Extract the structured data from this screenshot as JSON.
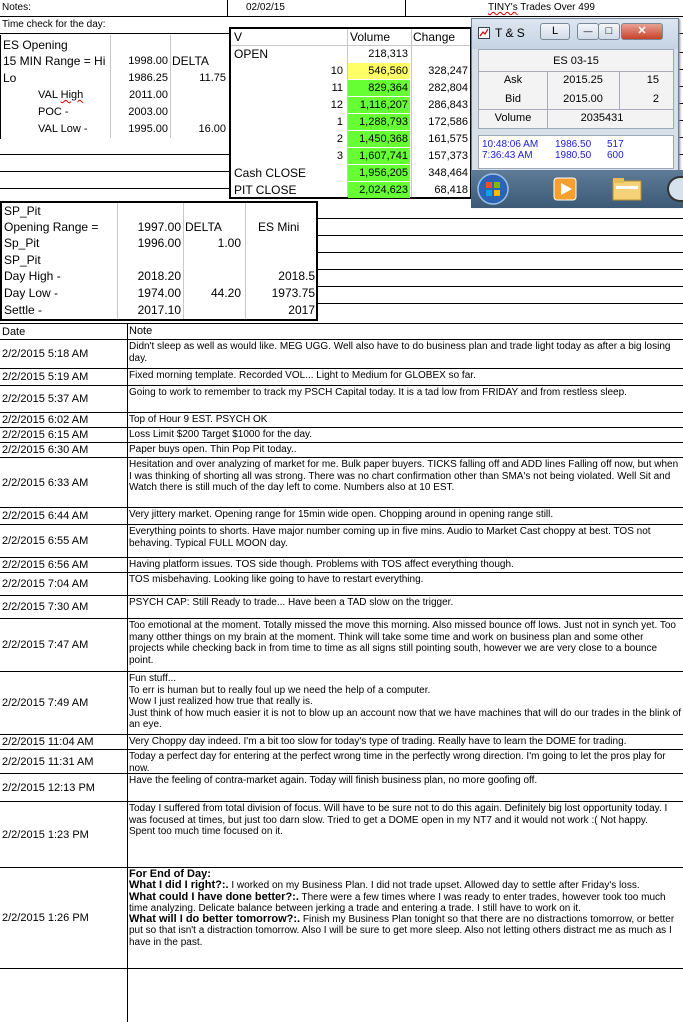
{
  "header": {
    "notes_label": "Notes:",
    "date": "02/02/15",
    "title_prefix": "TINY's",
    "title_suffix": " Trades Over 499",
    "time_check_label": "Time check for the day:"
  },
  "es_opening": {
    "title": "ES Opening",
    "rows": [
      {
        "label": "15 MIN Range = Hi",
        "value": "1998.00",
        "extra": "DELTA"
      },
      {
        "label": "Lo",
        "value": "1986.25",
        "extra": "11.75"
      },
      {
        "label": "VAL High",
        "value": "2011.00",
        "extra": ""
      },
      {
        "label": "POC  -",
        "value": "2003.00",
        "extra": ""
      },
      {
        "label": "VAL Low   -",
        "value": "1995.00",
        "extra": "16.00"
      }
    ]
  },
  "volume_table": {
    "col_v": "V",
    "col_volume": "Volume",
    "col_change": "Change",
    "rows": [
      {
        "label": "OPEN",
        "hour": "",
        "volume": "218,313",
        "change": "",
        "highlight": "none"
      },
      {
        "label": "",
        "hour": "10",
        "volume": "546,560",
        "change": "328,247",
        "highlight": "yellow"
      },
      {
        "label": "",
        "hour": "11",
        "volume": "829,364",
        "change": "282,804",
        "highlight": "green"
      },
      {
        "label": "",
        "hour": "12",
        "volume": "1,116,207",
        "change": "286,843",
        "highlight": "green"
      },
      {
        "label": "",
        "hour": "1",
        "volume": "1,288,793",
        "change": "172,586",
        "highlight": "green"
      },
      {
        "label": "",
        "hour": "2",
        "volume": "1,450,368",
        "change": "161,575",
        "highlight": "green"
      },
      {
        "label": "",
        "hour": "3",
        "volume": "1,607,741",
        "change": "157,373",
        "highlight": "green"
      },
      {
        "label": "Cash CLOSE",
        "hour": "",
        "volume": "1,956,205",
        "change": "348,464",
        "highlight": "green"
      },
      {
        "label": "PIT CLOSE",
        "hour": "",
        "volume": "2,024,623",
        "change": "68,418",
        "highlight": "green"
      }
    ],
    "colors": {
      "yellow": "#ffff66",
      "green": "#66ff33"
    }
  },
  "ts_window": {
    "title": "T & S",
    "btn_l": "L",
    "btn_min": "—",
    "btn_max": "□",
    "btn_close": "✕",
    "symbol": "ES 03-15",
    "ask_label": "Ask",
    "ask_price": "2015.25",
    "ask_size": "15",
    "bid_label": "Bid",
    "bid_price": "2015.00",
    "bid_size": "2",
    "volume_label": "Volume",
    "volume_value": "2035431",
    "trades": [
      {
        "time": "10:48:06 AM",
        "price": "1986.50",
        "size": "517"
      },
      {
        "time": "7:36:43 AM",
        "price": "1980.50",
        "size": "600"
      }
    ],
    "trade_color": "#1b1bd9"
  },
  "sp_pit": {
    "title": "SP_Pit",
    "opening_label": "Opening Range =",
    "opening_value": "1997.00",
    "delta_label": "DELTA",
    "es_mini_label": "ES Mini",
    "sp_pit_label": "Sp_Pit",
    "sp_pit_value": "1996.00",
    "sp_pit_delta": "1.00",
    "title2": "SP_Pit",
    "day_high_label": "Day High -",
    "day_high_value": "2018.20",
    "day_high_es": "2018.5",
    "day_low_label": "Day Low -",
    "day_low_value": "1974.00",
    "day_low_delta": "44.20",
    "day_low_es": "1973.75",
    "settle_label": "Settle -",
    "settle_value": "2017.10",
    "settle_es": "2017"
  },
  "notes": {
    "col_date": "Date",
    "col_note": "Note",
    "rows": [
      {
        "date": "2/2/2015 5:18 AM",
        "note": "Didn't sleep as well as would like.  MEG UGG.  Well also have to do business plan and trade light today as after a big losing day."
      },
      {
        "date": "2/2/2015 5:19 AM",
        "note": "Fixed morning template.  Recorded VOL... Light to Medium for GLOBEX so far."
      },
      {
        "date": "2/2/2015 5:37 AM",
        "note": "Going to work to remember to track my PSCH Capital today.  It is a tad low from FRIDAY and from restless sleep."
      },
      {
        "date": "2/2/2015 6:02 AM",
        "note": "Top of Hour 9 EST. PSYCH OK"
      },
      {
        "date": "2/2/2015 6:15 AM",
        "note": "Loss Limit $200 Target $1000 for the day."
      },
      {
        "date": "2/2/2015 6:30 AM",
        "note": "Paper buys open. Thin Pop Pit today.."
      },
      {
        "date": "2/2/2015 6:33 AM",
        "note": "Hesitation and over analyzing of market for me.  Bulk paper buyers.  TICKS falling off and ADD lines Falling off now, but when I was thinking of shorting all was strong.  There was no chart confirmation other than SMA's not being violated.  Well Sit and Watch there is still much of the day left to come.  Numbers also at 10 EST."
      },
      {
        "date": "2/2/2015 6:44 AM",
        "note": "Very jittery market.  Opening range for 15min wide open.  Chopping around in opening range still."
      },
      {
        "date": "2/2/2015 6:55 AM",
        "note": "Everything points to shorts.  Have major number coming up in five mins.  Audio to Market Cast choppy at best.  TOS not behaving.  Typical FULL MOON day."
      },
      {
        "date": "2/2/2015 6:56 AM",
        "note": "Having platform issues.  TOS side though.  Problems with TOS affect everything though."
      },
      {
        "date": "2/2/2015 7:04 AM",
        "note": "TOS misbehaving.   Looking like going to have to restart everything."
      },
      {
        "date": "2/2/2015 7:30 AM",
        "note": "PSYCH CAP:  Still Ready to trade... Have been a TAD slow on the trigger."
      },
      {
        "date": "2/2/2015 7:47 AM",
        "note": "Too emotional at the moment.  Totally missed the move this morning.  Also missed bounce off lows.  Just not in synch yet.  Too many otther things on my brain at the moment.  Think will take some time and work on business plan and some other projects while checking back in from time to time as all signs still pointing south, however we are very close to a bounce point."
      },
      {
        "date": "2/2/2015 7:49 AM",
        "note": "Fun stuff...\nTo err is human but to really foul up we need the help of a computer.\nWow I just realized how true that really is.\nJust think of how much easier it is not to blow up an account now that we have machines that will do our trades in the blink of an eye."
      },
      {
        "date": "2/2/2015 11:04 AM",
        "note": "Very Choppy day indeed.  I'm a bit too slow for today's type of trading.  Really have to learn the DOME for trading."
      },
      {
        "date": "2/2/2015 11:31 AM",
        "note": "Today a perfect day for entering at the perfect wrong time in the perfectly wrong direction.  I'm going to let the pros play for now."
      },
      {
        "date": "2/2/2015 12:13 PM",
        "note": "Have the feeling of contra-market again.  Today will finish business plan, no more goofing off."
      },
      {
        "date": "2/2/2015 1:23 PM",
        "note": "Today I suffered from total division of focus.  Will have to be sure not to do this again.  Definitely big lost opportunity today.  I was focused at times,  but just too darn slow.  Tried to get a DOME open in my NT7 and it would not work :( Not happy.\nSpent too much time focused on it."
      },
      {
        "date": "2/2/2015 1:26 PM",
        "note": ""
      }
    ],
    "eod": {
      "heading": "For End of Day:",
      "q1": "What I did I right?:.",
      "a1": "      I worked on my Business Plan.  I did not trade upset.  Allowed day to settle after Friday's loss.",
      "q2": "What could I have done better?:.",
      "a2": " There were a few times where I was ready to enter trades, however took too much time analyzing.  Delicate balance between jerking a trade and entering a trade.  I still have to work on it.",
      "q3": "What will I do better tomorrow?:.",
      "a3": "  Finish my Business Plan tonight so that there are no distractions tomorrow, or better put so that isn't a distraction tomorrow.  Also I will be sure to get more sleep.  Also not letting others distract me as much as I have in the past."
    }
  }
}
